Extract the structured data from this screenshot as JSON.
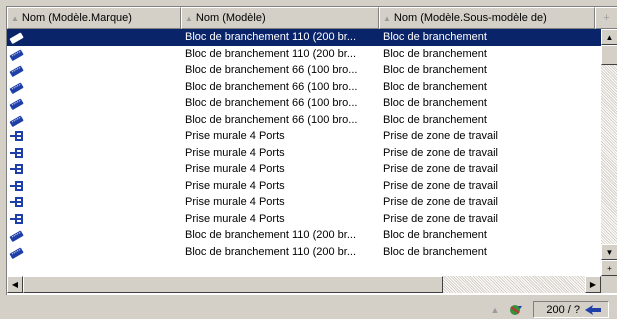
{
  "columns": [
    {
      "label": "Nom (Modèle.Marque)"
    },
    {
      "label": "Nom (Modèle)"
    },
    {
      "label": "Nom (Modèle.Sous-modèle de)"
    }
  ],
  "header_corner": "+",
  "rows": [
    {
      "icon": "patch-panel-icon",
      "model": "Bloc de branchement 110 (200 br...",
      "submodel": "Bloc de branchement",
      "selected": true
    },
    {
      "icon": "patch-panel-icon",
      "model": "Bloc de branchement 110 (200 br...",
      "submodel": "Bloc de branchement",
      "selected": false
    },
    {
      "icon": "patch-panel-icon",
      "model": "Bloc de branchement 66 (100 bro...",
      "submodel": "Bloc de branchement",
      "selected": false
    },
    {
      "icon": "patch-panel-icon",
      "model": "Bloc de branchement 66 (100 bro...",
      "submodel": "Bloc de branchement",
      "selected": false
    },
    {
      "icon": "patch-panel-icon",
      "model": "Bloc de branchement 66 (100 bro...",
      "submodel": "Bloc de branchement",
      "selected": false
    },
    {
      "icon": "patch-panel-icon",
      "model": "Bloc de branchement 66 (100 bro...",
      "submodel": "Bloc de branchement",
      "selected": false
    },
    {
      "icon": "wall-port-icon",
      "model": "Prise murale 4 Ports",
      "submodel": "Prise de zone de travail",
      "selected": false
    },
    {
      "icon": "wall-port-icon",
      "model": "Prise murale 4 Ports",
      "submodel": "Prise de zone de travail",
      "selected": false
    },
    {
      "icon": "wall-port-icon",
      "model": "Prise murale 4 Ports",
      "submodel": "Prise de zone de travail",
      "selected": false
    },
    {
      "icon": "wall-port-icon",
      "model": "Prise murale 4 Ports",
      "submodel": "Prise de zone de travail",
      "selected": false
    },
    {
      "icon": "wall-port-icon",
      "model": "Prise murale 4 Ports",
      "submodel": "Prise de zone de travail",
      "selected": false
    },
    {
      "icon": "wall-port-icon",
      "model": "Prise murale 4 Ports",
      "submodel": "Prise de zone de travail",
      "selected": false
    },
    {
      "icon": "patch-panel-icon",
      "model": "Bloc de branchement 110 (200 br...",
      "submodel": "Bloc de branchement",
      "selected": false
    },
    {
      "icon": "patch-panel-icon",
      "model": "Bloc de branchement 110 (200 br...",
      "submodel": "Bloc de branchement",
      "selected": false
    }
  ],
  "status": {
    "record_count": "200 / ?"
  },
  "colors": {
    "selection": "#0a246a",
    "face": "#d4d0c8",
    "icon_blue": "#1f3fa8"
  }
}
